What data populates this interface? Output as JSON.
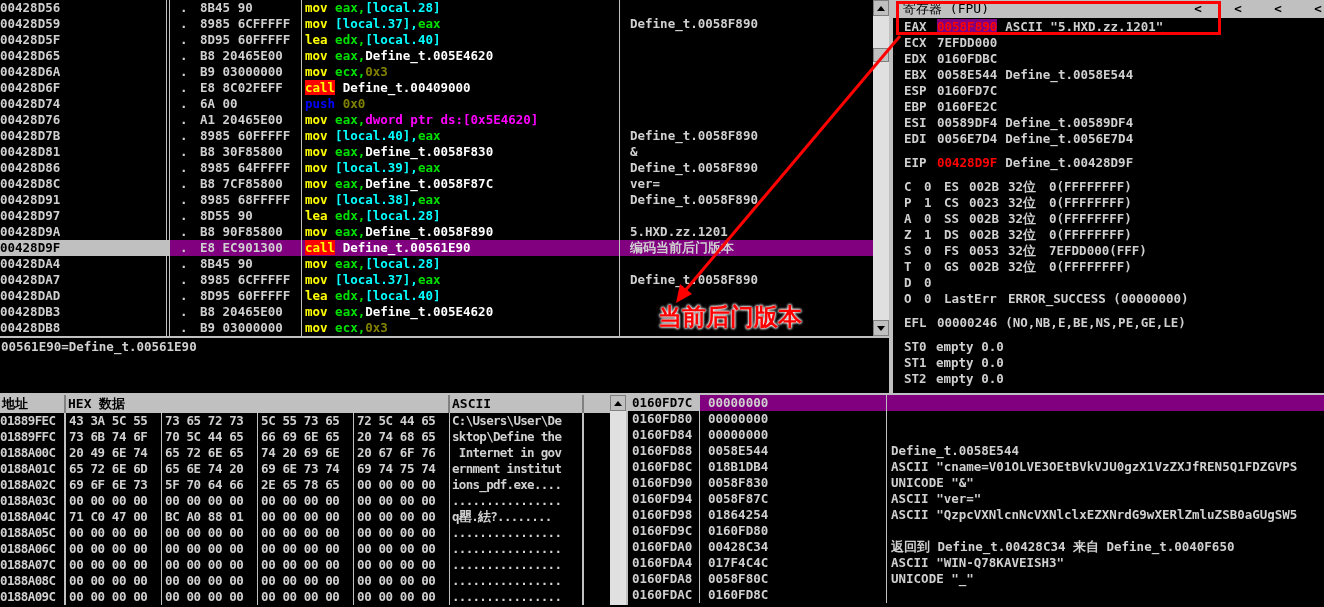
{
  "disassembly": {
    "rows": [
      {
        "address": "00428D56",
        "marker": ".",
        "bytes": "8B45 90",
        "mnemonic": {
          "text": "mov",
          "kind": "op"
        },
        "operands": [
          {
            "text": "eax,",
            "kind": "reg"
          },
          {
            "text": "[local.28]",
            "kind": "mem"
          }
        ],
        "selected": false
      },
      {
        "address": "00428D59",
        "marker": ".",
        "bytes": "8985 6CFFFFF",
        "mnemonic": {
          "text": "mov",
          "kind": "op"
        },
        "operands": [
          {
            "text": "[local.37],",
            "kind": "mem"
          },
          {
            "text": "eax",
            "kind": "reg"
          }
        ],
        "comment": "Define_t.0058F890",
        "selected": false
      },
      {
        "address": "00428D5F",
        "marker": ".",
        "bytes": "8D95 60FFFFF",
        "mnemonic": {
          "text": "lea",
          "kind": "op"
        },
        "operands": [
          {
            "text": "edx,",
            "kind": "reg"
          },
          {
            "text": "[local.40]",
            "kind": "mem"
          }
        ],
        "selected": false
      },
      {
        "address": "00428D65",
        "marker": ".",
        "bytes": "B8 20465E00",
        "mnemonic": {
          "text": "mov",
          "kind": "op"
        },
        "operands": [
          {
            "text": "eax,",
            "kind": "reg"
          },
          {
            "text": "Define_t.005E4620",
            "kind": "sym"
          }
        ],
        "selected": false
      },
      {
        "address": "00428D6A",
        "marker": ".",
        "bytes": "B9 03000000",
        "mnemonic": {
          "text": "mov",
          "kind": "op"
        },
        "operands": [
          {
            "text": "ecx,",
            "kind": "reg"
          },
          {
            "text": "0x3",
            "kind": "imm"
          }
        ],
        "selected": false
      },
      {
        "address": "00428D6F",
        "marker": ".",
        "bytes": "E8 8C02FEFF",
        "mnemonic": {
          "text": "call",
          "kind": "call"
        },
        "operands": [
          {
            "text": "Define_t.00409000",
            "kind": "sym"
          }
        ],
        "selected": false
      },
      {
        "address": "00428D74",
        "marker": ".",
        "bytes": "6A 00",
        "mnemonic": {
          "text": "push",
          "kind": "push"
        },
        "operands": [
          {
            "text": "0x0",
            "kind": "imm"
          }
        ],
        "selected": false
      },
      {
        "address": "00428D76",
        "marker": ".",
        "bytes": "A1 20465E00",
        "mnemonic": {
          "text": "mov",
          "kind": "op"
        },
        "operands": [
          {
            "text": "eax,",
            "kind": "reg"
          },
          {
            "text": "dword ptr ds:[0x5E4620]",
            "kind": "ptr"
          }
        ],
        "selected": false
      },
      {
        "address": "00428D7B",
        "marker": ".",
        "bytes": "8985 60FFFFF",
        "mnemonic": {
          "text": "mov",
          "kind": "op"
        },
        "operands": [
          {
            "text": "[local.40],",
            "kind": "mem"
          },
          {
            "text": "eax",
            "kind": "reg"
          }
        ],
        "comment": "Define_t.0058F890",
        "selected": false
      },
      {
        "address": "00428D81",
        "marker": ".",
        "bytes": "B8 30F85800",
        "mnemonic": {
          "text": "mov",
          "kind": "op"
        },
        "operands": [
          {
            "text": "eax,",
            "kind": "reg"
          },
          {
            "text": "Define_t.0058F830",
            "kind": "sym"
          }
        ],
        "comment": "&",
        "selected": false
      },
      {
        "address": "00428D86",
        "marker": ".",
        "bytes": "8985 64FFFFF",
        "mnemonic": {
          "text": "mov",
          "kind": "op"
        },
        "operands": [
          {
            "text": "[local.39],",
            "kind": "mem"
          },
          {
            "text": "eax",
            "kind": "reg"
          }
        ],
        "comment": "Define_t.0058F890",
        "selected": false
      },
      {
        "address": "00428D8C",
        "marker": ".",
        "bytes": "B8 7CF85800",
        "mnemonic": {
          "text": "mov",
          "kind": "op"
        },
        "operands": [
          {
            "text": "eax,",
            "kind": "reg"
          },
          {
            "text": "Define_t.0058F87C",
            "kind": "sym"
          }
        ],
        "comment": "ver=",
        "selected": false
      },
      {
        "address": "00428D91",
        "marker": ".",
        "bytes": "8985 68FFFFF",
        "mnemonic": {
          "text": "mov",
          "kind": "op"
        },
        "operands": [
          {
            "text": "[local.38],",
            "kind": "mem"
          },
          {
            "text": "eax",
            "kind": "reg"
          }
        ],
        "comment": "Define_t.0058F890",
        "selected": false
      },
      {
        "address": "00428D97",
        "marker": ".",
        "bytes": "8D55 90",
        "mnemonic": {
          "text": "lea",
          "kind": "op"
        },
        "operands": [
          {
            "text": "edx,",
            "kind": "reg"
          },
          {
            "text": "[local.28]",
            "kind": "mem"
          }
        ],
        "selected": false
      },
      {
        "address": "00428D9A",
        "marker": ".",
        "bytes": "B8 90F85800",
        "mnemonic": {
          "text": "mov",
          "kind": "op"
        },
        "operands": [
          {
            "text": "eax,",
            "kind": "reg"
          },
          {
            "text": "Define_t.0058F890",
            "kind": "sym"
          }
        ],
        "comment": "5.HXD.zz.1201",
        "selected": false
      },
      {
        "address": "00428D9F",
        "marker": ".",
        "bytes": "E8 EC901300",
        "mnemonic": {
          "text": "call",
          "kind": "call"
        },
        "operands": [
          {
            "text": "Define_t.00561E90",
            "kind": "sym"
          }
        ],
        "comment": "编码当前后门版本",
        "selected": true
      },
      {
        "address": "00428DA4",
        "marker": ".",
        "bytes": "8B45 90",
        "mnemonic": {
          "text": "mov",
          "kind": "op"
        },
        "operands": [
          {
            "text": "eax,",
            "kind": "reg"
          },
          {
            "text": "[local.28]",
            "kind": "mem"
          }
        ],
        "selected": false
      },
      {
        "address": "00428DA7",
        "marker": ".",
        "bytes": "8985 6CFFFFF",
        "mnemonic": {
          "text": "mov",
          "kind": "op"
        },
        "operands": [
          {
            "text": "[local.37],",
            "kind": "mem"
          },
          {
            "text": "eax",
            "kind": "reg"
          }
        ],
        "comment": "Define_t.0058F890",
        "selected": false
      },
      {
        "address": "00428DAD",
        "marker": ".",
        "bytes": "8D95 60FFFFF",
        "mnemonic": {
          "text": "lea",
          "kind": "op"
        },
        "operands": [
          {
            "text": "edx,",
            "kind": "reg"
          },
          {
            "text": "[local.40]",
            "kind": "mem"
          }
        ],
        "selected": false
      },
      {
        "address": "00428DB3",
        "marker": ".",
        "bytes": "B8 20465E00",
        "mnemonic": {
          "text": "mov",
          "kind": "op"
        },
        "operands": [
          {
            "text": "eax,",
            "kind": "reg"
          },
          {
            "text": "Define_t.005E4620",
            "kind": "sym"
          }
        ],
        "selected": false
      },
      {
        "address": "00428DB8",
        "marker": ".",
        "bytes": "B9 03000000",
        "mnemonic": {
          "text": "mov",
          "kind": "op"
        },
        "operands": [
          {
            "text": "ecx,",
            "kind": "reg"
          },
          {
            "text": "0x3",
            "kind": "imm"
          }
        ],
        "selected": false
      }
    ]
  },
  "info_pane": {
    "text": "00561E90=Define_t.00561E90"
  },
  "registers": {
    "title": "寄存器 (FPU)",
    "header_buttons": [
      "<",
      "<",
      "<",
      "<"
    ],
    "groups": [
      [
        {
          "kind": "reg",
          "name": "EAX",
          "value": "0058F890",
          "comment": "ASCII \"5.HXD.zz.1201\"",
          "changed": true,
          "selected": true
        },
        {
          "kind": "reg",
          "name": "ECX",
          "value": "7EFDD000",
          "changed": false,
          "selected": false
        },
        {
          "kind": "reg",
          "name": "EDX",
          "value": "0160FDBC",
          "changed": false,
          "selected": false
        },
        {
          "kind": "reg",
          "name": "EBX",
          "value": "0058E544",
          "comment": "Define_t.0058E544",
          "changed": false,
          "selected": false
        },
        {
          "kind": "reg",
          "name": "ESP",
          "value": "0160FD7C",
          "changed": false,
          "selected": false
        },
        {
          "kind": "reg",
          "name": "EBP",
          "value": "0160FE2C",
          "changed": false,
          "selected": false
        },
        {
          "kind": "reg",
          "name": "ESI",
          "value": "00589DF4",
          "comment": "Define_t.00589DF4",
          "changed": false,
          "selected": false
        },
        {
          "kind": "reg",
          "name": "EDI",
          "value": "0056E7D4",
          "comment": "Define_t.0056E7D4",
          "changed": false,
          "selected": false
        }
      ],
      [
        {
          "kind": "reg",
          "name": "EIP",
          "value": "00428D9F",
          "comment": "Define_t.00428D9F",
          "changed": true,
          "selected": false
        }
      ],
      [
        {
          "kind": "flag",
          "flag": "C",
          "bit": "0",
          "segment": "ES",
          "selector": "002B",
          "bits": "32位",
          "base": "0(FFFFFFFF)"
        },
        {
          "kind": "flag",
          "flag": "P",
          "bit": "1",
          "segment": "CS",
          "selector": "0023",
          "bits": "32位",
          "base": "0(FFFFFFFF)"
        },
        {
          "kind": "flag",
          "flag": "A",
          "bit": "0",
          "segment": "SS",
          "selector": "002B",
          "bits": "32位",
          "base": "0(FFFFFFFF)"
        },
        {
          "kind": "flag",
          "flag": "Z",
          "bit": "1",
          "segment": "DS",
          "selector": "002B",
          "bits": "32位",
          "base": "0(FFFFFFFF)"
        },
        {
          "kind": "flag",
          "flag": "S",
          "bit": "0",
          "segment": "FS",
          "selector": "0053",
          "bits": "32位",
          "base": "7EFDD000(FFF)"
        },
        {
          "kind": "flag",
          "flag": "T",
          "bit": "0",
          "segment": "GS",
          "selector": "002B",
          "bits": "32位",
          "base": "0(FFFFFFFF)"
        },
        {
          "kind": "flag",
          "flag": "D",
          "bit": "0"
        },
        {
          "kind": "lasterr",
          "flag": "O",
          "bit": "0",
          "label": "LastErr",
          "value": "ERROR_SUCCESS (00000000)"
        }
      ],
      [
        {
          "kind": "reg",
          "name": "EFL",
          "value": "00000246",
          "comment": "(NO,NB,E,BE,NS,PE,GE,LE)",
          "changed": false,
          "selected": false
        }
      ],
      [
        {
          "kind": "fpu",
          "name": "ST0",
          "value": "empty 0.0"
        },
        {
          "kind": "fpu",
          "name": "ST1",
          "value": "empty 0.0"
        },
        {
          "kind": "fpu",
          "name": "ST2",
          "value": "empty 0.0"
        }
      ]
    ]
  },
  "hex_dump": {
    "columns": [
      "地址",
      "HEX 数据",
      "ASCII"
    ],
    "rows": [
      {
        "address": "01889FEC",
        "groups": [
          "43 3A 5C 55",
          "73 65 72 73",
          "5C 55 73 65",
          "72 5C 44 65"
        ],
        "ascii": "C:\\Users\\User\\De"
      },
      {
        "address": "01889FFC",
        "groups": [
          "73 6B 74 6F",
          "70 5C 44 65",
          "66 69 6E 65",
          "20 74 68 65"
        ],
        "ascii": "sktop\\Define the"
      },
      {
        "address": "0188A00C",
        "groups": [
          "20 49 6E 74",
          "65 72 6E 65",
          "74 20 69 6E",
          "20 67 6F 76"
        ],
        "ascii": " Internet in gov"
      },
      {
        "address": "0188A01C",
        "groups": [
          "65 72 6E 6D",
          "65 6E 74 20",
          "69 6E 73 74",
          "69 74 75 74"
        ],
        "ascii": "ernment institut"
      },
      {
        "address": "0188A02C",
        "groups": [
          "69 6F 6E 73",
          "5F 70 64 66",
          "2E 65 78 65",
          "00 00 00 00"
        ],
        "ascii": "ions_pdf.exe...."
      },
      {
        "address": "0188A03C",
        "groups": [
          "00 00 00 00",
          "00 00 00 00",
          "00 00 00 00",
          "00 00 00 00"
        ],
        "ascii": "................"
      },
      {
        "address": "0188A04C",
        "groups": [
          "71 C0 47 00",
          "BC A0 88 01",
          "00 00 00 00",
          "00 00 00 00"
        ],
        "ascii": "q罌.紶?........"
      },
      {
        "address": "0188A05C",
        "groups": [
          "00 00 00 00",
          "00 00 00 00",
          "00 00 00 00",
          "00 00 00 00"
        ],
        "ascii": "................"
      },
      {
        "address": "0188A06C",
        "groups": [
          "00 00 00 00",
          "00 00 00 00",
          "00 00 00 00",
          "00 00 00 00"
        ],
        "ascii": "................"
      },
      {
        "address": "0188A07C",
        "groups": [
          "00 00 00 00",
          "00 00 00 00",
          "00 00 00 00",
          "00 00 00 00"
        ],
        "ascii": "................"
      },
      {
        "address": "0188A08C",
        "groups": [
          "00 00 00 00",
          "00 00 00 00",
          "00 00 00 00",
          "00 00 00 00"
        ],
        "ascii": "................"
      },
      {
        "address": "0188A09C",
        "groups": [
          "00 00 00 00",
          "00 00 00 00",
          "00 00 00 00",
          "00 00 00 00"
        ],
        "ascii": "................"
      }
    ]
  },
  "stack": {
    "rows": [
      {
        "address": "0160FD7C",
        "value": "00000000",
        "selected": true
      },
      {
        "address": "0160FD80",
        "value": "00000000",
        "selected": false
      },
      {
        "address": "0160FD84",
        "value": "00000000",
        "selected": false
      },
      {
        "address": "0160FD88",
        "value": "0058E544",
        "comment": "Define_t.0058E544",
        "selected": false
      },
      {
        "address": "0160FD8C",
        "value": "018B1DB4",
        "comment": "ASCII \"cname=V01OLVE3OEtBVkVJU0gzX1VzZXJfREN5Q1FDZGVPS",
        "selected": false
      },
      {
        "address": "0160FD90",
        "value": "0058F830",
        "comment": "UNICODE \"&\"",
        "selected": false
      },
      {
        "address": "0160FD94",
        "value": "0058F87C",
        "comment": "ASCII \"ver=\"",
        "selected": false
      },
      {
        "address": "0160FD98",
        "value": "01864254",
        "comment": "ASCII \"QzpcVXNlcnNcVXNlclxEZXNrdG9wXERlZmluZSB0aGUgSW5",
        "selected": false
      },
      {
        "address": "0160FD9C",
        "value": "0160FD80",
        "selected": false
      },
      {
        "address": "0160FDA0",
        "value": "00428C34",
        "comment": "返回到 Define_t.00428C34 来自 Define_t.0040F650",
        "selected": false
      },
      {
        "address": "0160FDA4",
        "value": "017F4C4C",
        "comment": "ASCII \"WIN-Q78KAVEISH3\"",
        "selected": false
      },
      {
        "address": "0160FDA8",
        "value": "0058F80C",
        "comment": "UNICODE \"_\"",
        "selected": false
      },
      {
        "address": "0160FDAC",
        "value": "0160FD8C",
        "selected": false
      }
    ]
  },
  "annotation": {
    "label": "当前后门版本"
  }
}
